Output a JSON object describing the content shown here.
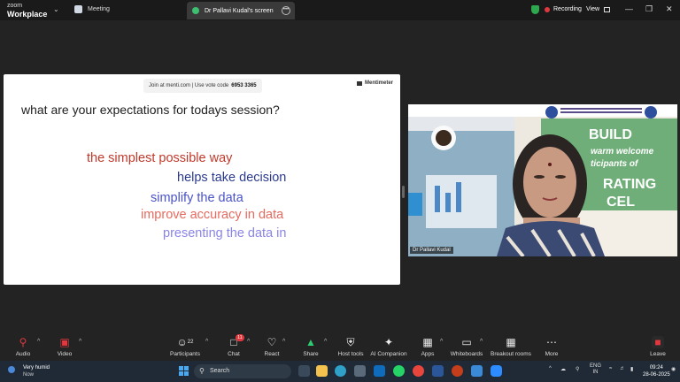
{
  "titlebar": {
    "brand_line1": "zoom",
    "brand_line2": "Workplace",
    "meeting_label": "Meeting",
    "screen_tab": "Dr Pallavi Kudal's screen",
    "recording": "Recording",
    "view": "View"
  },
  "share": {
    "vote_prefix": "Join at menti.com | Use vote code",
    "vote_code": "6953 3365",
    "menti_brand": "Mentimeter",
    "question": "what are your expectations  for todays session?",
    "responses": [
      "the simplest possible way",
      "helps take decision",
      "simplify the data",
      "improve accuracy in data",
      "presenting the data in"
    ],
    "colors": [
      "#c0392b",
      "#2b3a8f",
      "#4a52c8",
      "#e8695e",
      "#8a84e8"
    ]
  },
  "video": {
    "participant_name": "Dr Pallavi Kudal",
    "slide_text_1": "BUILD",
    "slide_text_2": "warm welcome",
    "slide_text_3": "ticipants of",
    "slide_text_4": "RATING",
    "slide_text_5": "CEL"
  },
  "toolbar": {
    "audio": "Audio",
    "video": "Video",
    "participants": "Participants",
    "participants_count": "22",
    "chat": "Chat",
    "chat_badge": "11",
    "react": "React",
    "share": "Share",
    "host_tools": "Host tools",
    "ai_companion": "AI Companion",
    "apps": "Apps",
    "whiteboards": "Whiteboards",
    "breakout": "Breakout rooms",
    "more": "More",
    "leave": "Leave"
  },
  "taskbar": {
    "weather_line1": "Very humid",
    "weather_line2": "Now",
    "search": "Search",
    "lang1": "ENG",
    "lang2": "IN",
    "time": "09:24",
    "date": "28-06-2025"
  }
}
